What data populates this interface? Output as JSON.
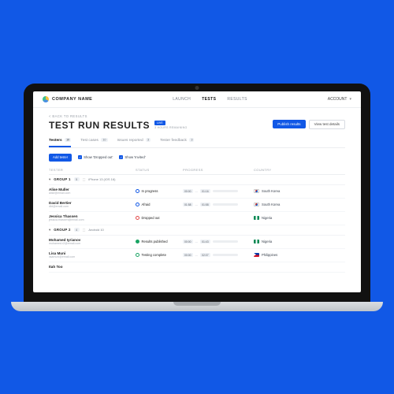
{
  "brand": {
    "name": "COMPANY NAME"
  },
  "nav": {
    "launch": "LAUNCH",
    "tests": "TESTS",
    "results": "RESULTS"
  },
  "account": {
    "label": "ACCOUNT"
  },
  "back": "< BACK TO RESULTS",
  "title": "TEST RUN RESULTS",
  "run_badge": "LIVE",
  "time_remaining": "3 HOURS REMAINING",
  "actions": {
    "publish": "Publish results",
    "details": "View test details"
  },
  "tabs": {
    "testers": {
      "label": "Testers",
      "count": "10"
    },
    "cases": {
      "label": "Test cases",
      "count": "10"
    },
    "issues": {
      "label": "Issues reported",
      "count": "3"
    },
    "feedback": {
      "label": "Tester feedback",
      "count": "3"
    }
  },
  "toolbar": {
    "add": "Add tester",
    "show_dropped": "Show 'Dropped out'",
    "show_invited": "Show 'Invited'"
  },
  "columns": {
    "tester": "TESTER",
    "status": "STATUS",
    "progress": "PROGRESS",
    "country": "COUNTRY"
  },
  "groups": [
    {
      "name": "GROUP 1",
      "count": "5",
      "device": "iPhone 13 (iOS 16)",
      "rows": [
        {
          "name": "Alise Muller",
          "email": "alise@email.com",
          "status": "In progress",
          "statusClass": "blue",
          "from": "00:00",
          "to": "01:16",
          "pct": 35,
          "fillClass": "",
          "country": "South Korea",
          "flag": "kr"
        },
        {
          "name": "David Bertier",
          "email": "dbt@email.com",
          "status": "Afraid",
          "statusClass": "blue",
          "from": "01:58",
          "to": "01:58",
          "pct": 0,
          "fillClass": "",
          "country": "South Korea",
          "flag": "kr"
        },
        {
          "name": "Jessica Thassen",
          "email": "jessica.thassen@email.com",
          "status": "Dropped out",
          "statusClass": "red",
          "from": "",
          "to": "",
          "pct": null,
          "fillClass": "",
          "country": "Nigeria",
          "flag": "ng"
        }
      ]
    },
    {
      "name": "GROUP 2",
      "count": "4",
      "device": "Android 10",
      "rows": [
        {
          "name": "Mohamed Iyrianov",
          "email": "mohamed.r2@email.com",
          "status": "Results published",
          "statusClass": "fill-green",
          "from": "00:00",
          "to": "01:43",
          "pct": 100,
          "fillClass": "green",
          "country": "Nigeria",
          "flag": "ng"
        },
        {
          "name": "Lisa Muni",
          "email": "lisamuni@email.com",
          "status": "Testing complete",
          "statusClass": "green",
          "from": "00:00",
          "to": "02:07",
          "pct": 100,
          "fillClass": "green",
          "country": "Philippines",
          "flag": "ph"
        },
        {
          "name": "Itah Too",
          "email": "",
          "status": "",
          "statusClass": "",
          "from": "",
          "to": "",
          "pct": null,
          "fillClass": "",
          "country": "",
          "flag": ""
        }
      ]
    }
  ]
}
